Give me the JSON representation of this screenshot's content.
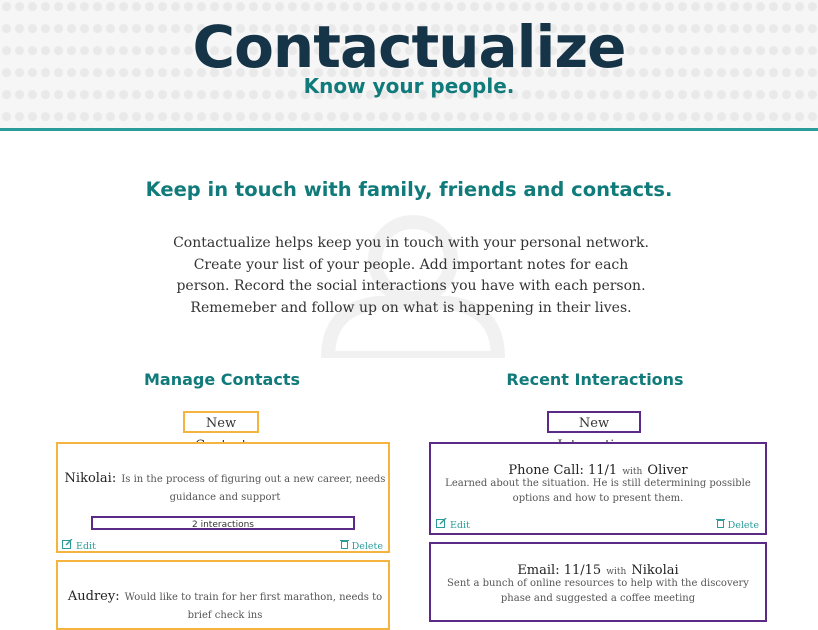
{
  "header": {
    "brand": "Contactualize",
    "tagline": "Know your people."
  },
  "intro": {
    "headline": "Keep in touch with family, friends and contacts.",
    "body": "Contactualize helps keep you in touch with your personal network. Create your list of your people. Add important notes for each person. Record the social interactions you have with each person. Rememeber and follow up on what is happening in their lives."
  },
  "contacts": {
    "title": "Manage Contacts",
    "new_button": "New Contact",
    "items": [
      {
        "name": "Nikolai:",
        "note": "Is in the process of figuring out a new career, needs guidance and support",
        "interactions_label": "2 interactions",
        "edit_label": "Edit",
        "delete_label": "Delete"
      },
      {
        "name": "Audrey:",
        "note": "Would like to train for her first marathon, needs to brief check ins"
      }
    ]
  },
  "interactions": {
    "title": "Recent Interactions",
    "new_button": "New Interaction",
    "items": [
      {
        "type": "Phone Call: 11/1",
        "with": "with",
        "person": "Oliver",
        "desc": "Learned about the situation. He is still determining possible options and how to present them.",
        "edit_label": "Edit",
        "delete_label": "Delete"
      },
      {
        "type": "Email: 11/15",
        "with": "with",
        "person": "Nikolai",
        "desc": "Sent a bunch of online resources to help with the discovery phase and suggested a coffee meeting"
      }
    ]
  },
  "icons": {
    "edit": "edit-icon",
    "delete": "trash-icon",
    "watermark": "person-silhouette"
  },
  "colors": {
    "teal": "#117a7a",
    "navy": "#163447",
    "orange": "#f4b43e",
    "purple": "#5b2a86"
  }
}
